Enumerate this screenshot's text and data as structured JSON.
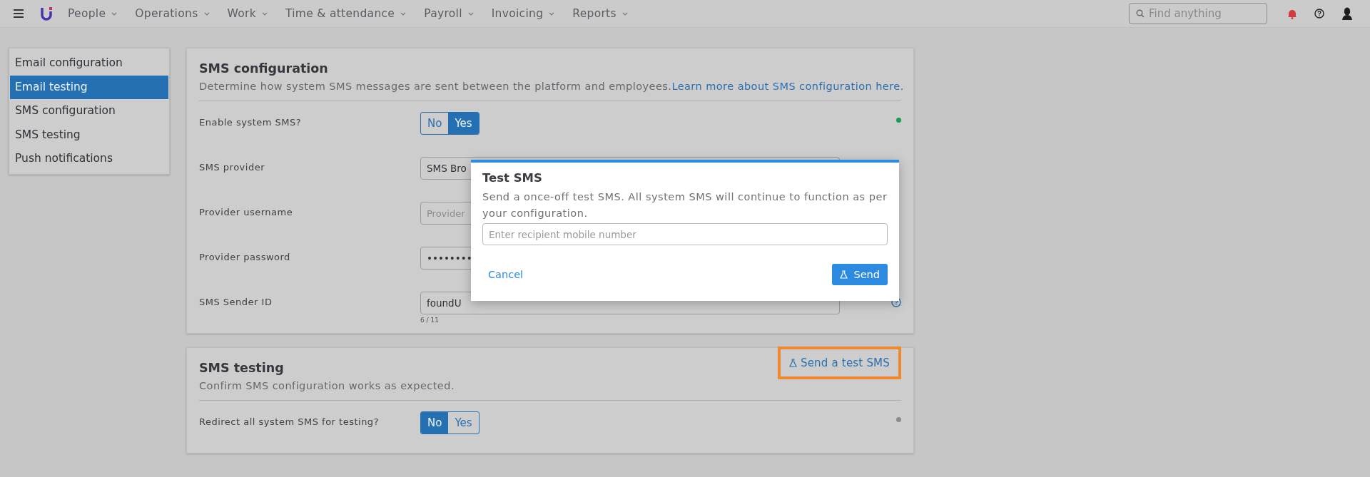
{
  "topbar": {
    "nav": [
      {
        "label": "People"
      },
      {
        "label": "Operations"
      },
      {
        "label": "Work"
      },
      {
        "label": "Time & attendance"
      },
      {
        "label": "Payroll"
      },
      {
        "label": "Invoicing"
      },
      {
        "label": "Reports"
      }
    ],
    "search": {
      "placeholder": "Find anything"
    }
  },
  "sidebar": {
    "items": [
      {
        "label": "Email configuration",
        "selected": false
      },
      {
        "label": "Email testing",
        "selected": true
      },
      {
        "label": "SMS configuration",
        "selected": false
      },
      {
        "label": "SMS testing",
        "selected": false
      },
      {
        "label": "Push notifications",
        "selected": false
      }
    ]
  },
  "sms_configuration": {
    "title": "SMS configuration",
    "description": "Determine how system SMS messages are sent between the platform and employees.",
    "link": "Learn more about SMS configuration here.",
    "settings": [
      {
        "kind": "toggle",
        "label": "Enable system SMS?",
        "options": [
          {
            "label": "No",
            "selected": false
          },
          {
            "label": "Yes",
            "selected": true
          }
        ],
        "color": "#1a9c4e"
      },
      {
        "kind": "select",
        "label": "SMS provider",
        "value": "SMS Bro"
      },
      {
        "kind": "input",
        "label": "Provider username",
        "placeholder": "Provider"
      },
      {
        "kind": "input",
        "label": "Provider password",
        "value": "••••••••"
      },
      {
        "kind": "input",
        "label": "SMS Sender ID",
        "value": "foundU",
        "counter": "6 / 11",
        "help": true
      }
    ]
  },
  "sms_testing": {
    "title": "SMS testing",
    "description": "Confirm SMS configuration works as expected.",
    "action": {
      "label": "Send a test SMS",
      "highlighted": true
    },
    "settings": [
      {
        "kind": "toggle",
        "label": "Redirect all system SMS for testing?",
        "options": [
          {
            "label": "No",
            "selected": true
          },
          {
            "label": "Yes",
            "selected": false
          }
        ],
        "color": "#8c8c8c"
      }
    ]
  },
  "dialog": {
    "title": "Test SMS",
    "message": "Send a once-off test SMS. All system SMS will continue to function as per your configuration.",
    "field": {
      "placeholder": "Enter recipient mobile number"
    },
    "cancel": "Cancel",
    "confirm": "Send"
  }
}
